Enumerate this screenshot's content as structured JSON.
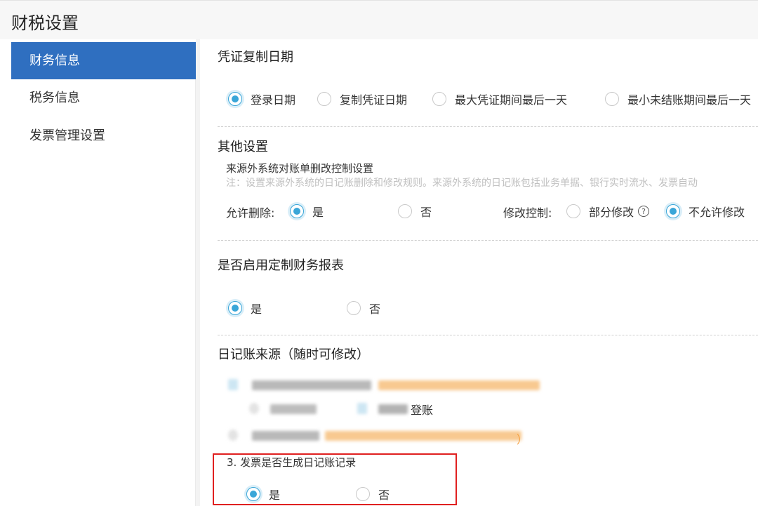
{
  "header": {
    "title": "财税设置"
  },
  "sidebar": {
    "items": [
      {
        "label": "财务信息",
        "active": true
      },
      {
        "label": "税务信息",
        "active": false
      },
      {
        "label": "发票管理设置",
        "active": false
      }
    ]
  },
  "voucher_copy_date": {
    "title": "凭证复制日期",
    "options": [
      {
        "label": "登录日期",
        "checked": true
      },
      {
        "label": "复制凭证日期",
        "checked": false
      },
      {
        "label": "最大凭证期间最后一天",
        "checked": false
      },
      {
        "label": "最小未结账期间最后一天",
        "checked": false
      }
    ]
  },
  "other_settings": {
    "title": "其他设置",
    "subtitle": "来源外系统对账单删改控制设置",
    "note": "注：设置来源外系统的日记账删除和修改规则。来源外系统的日记账包括业务单据、银行实时流水、发票自动",
    "allow_delete_label": "允许删除:",
    "allow_delete_options": [
      {
        "label": "是",
        "checked": true
      },
      {
        "label": "否",
        "checked": false
      }
    ],
    "modify_control_label": "修改控制:",
    "modify_control_options": [
      {
        "label": "部分修改",
        "checked": false
      },
      {
        "label": "不允许修改",
        "checked": true
      }
    ],
    "help_glyph": "?"
  },
  "custom_reports": {
    "title": "是否启用定制财务报表",
    "options": [
      {
        "label": "是",
        "checked": true
      },
      {
        "label": "否",
        "checked": false
      }
    ]
  },
  "journal_source": {
    "title": "日记账来源（随时可修改）",
    "partial_label_1": "登账",
    "partial_tail_2": "）",
    "invoice_question": "3. 发票是否生成日记账记录",
    "invoice_options": [
      {
        "label": "是",
        "checked": true
      },
      {
        "label": "否",
        "checked": false
      }
    ]
  },
  "colors": {
    "accent": "#3aa6d8",
    "nav_active": "#2f6fc0",
    "highlight_border": "#e02020",
    "orange": "#f5a040"
  }
}
